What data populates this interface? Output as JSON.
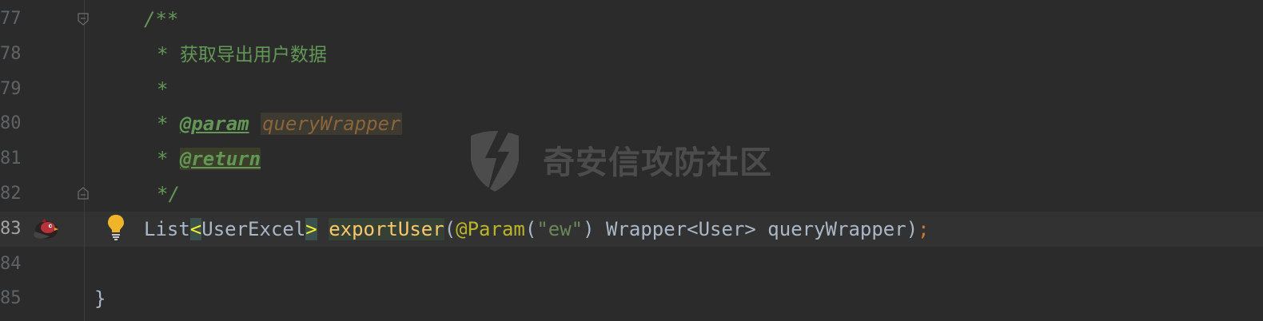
{
  "editor": {
    "lines": [
      {
        "num": "77",
        "parts": [
          "/**"
        ]
      },
      {
        "num": "78",
        "parts": [
          "* ",
          "获取导出用户数据"
        ]
      },
      {
        "num": "79",
        "parts": [
          "*"
        ]
      },
      {
        "num": "80",
        "parts": [
          "* ",
          "@param",
          " ",
          "queryWrapper"
        ]
      },
      {
        "num": "81",
        "parts": [
          "* ",
          "@return"
        ]
      },
      {
        "num": "82",
        "parts": [
          "*/"
        ]
      },
      {
        "num": "83",
        "parts": [
          "List",
          "<",
          "UserExcel",
          ">",
          " ",
          "exportUser",
          "(",
          "@Param",
          "(",
          "\"ew\"",
          ") Wrapper<User> queryWrapper)",
          ";"
        ]
      },
      {
        "num": "84",
        "parts": []
      },
      {
        "num": "85",
        "parts": [
          "}"
        ]
      }
    ]
  },
  "watermark": {
    "text": "奇安信攻防社区"
  },
  "colors": {
    "background": "#2b2b2b",
    "comment": "#629755",
    "method": "#ffc66d",
    "annotation": "#bbb529",
    "string": "#6a8759",
    "keyword": "#cc7832",
    "text": "#a9b7c6",
    "line_number": "#606366"
  },
  "icons": {
    "fold_start": "fold-collapse-icon",
    "fold_end": "fold-end-icon",
    "intention": "lightbulb-icon",
    "gutter_avatar": "bird-avatar-icon"
  }
}
